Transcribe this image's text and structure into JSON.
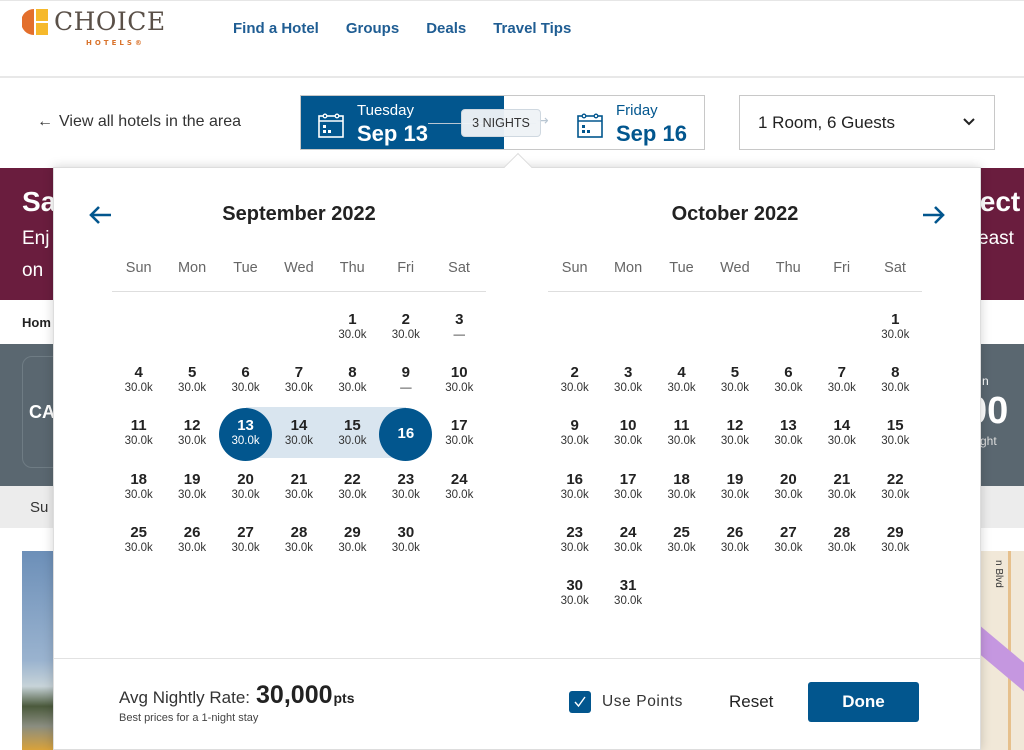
{
  "header": {
    "logo_word": "CHOICE",
    "logo_sub": "HOTELS®",
    "nav": [
      "Find a Hotel",
      "Groups",
      "Deals",
      "Travel Tips"
    ]
  },
  "search": {
    "back_link": "View all hotels in the area",
    "checkin": {
      "day": "Tuesday",
      "date": "Sep 13"
    },
    "checkout": {
      "day": "Friday",
      "date": "Sep 16"
    },
    "nights": "3 NIGHTS",
    "guests": "1 Room, 6 Guests"
  },
  "background": {
    "promo_title": "Sa",
    "promo_line1": "Enj",
    "promo_line2": "on",
    "promo_right_title": "lect",
    "promo_right_line": "east",
    "breadcrumb": "Hom",
    "band_left": "CA",
    "band_right_top": "n",
    "band_right_big": "00",
    "band_right_bottom": "ght",
    "subbar": "Su",
    "map_label": "n Blvd"
  },
  "calendar": {
    "weekdays": [
      "Sun",
      "Mon",
      "Tue",
      "Wed",
      "Thu",
      "Fri",
      "Sat"
    ],
    "selected_start": "2022-09-13",
    "selected_end": "2022-09-16",
    "months": [
      {
        "title": "September 2022",
        "first_weekday": 4,
        "days": [
          {
            "d": "1",
            "p": "30.0k"
          },
          {
            "d": "2",
            "p": "30.0k"
          },
          {
            "d": "3",
            "p": "—"
          },
          {
            "d": "4",
            "p": "30.0k"
          },
          {
            "d": "5",
            "p": "30.0k"
          },
          {
            "d": "6",
            "p": "30.0k"
          },
          {
            "d": "7",
            "p": "30.0k"
          },
          {
            "d": "8",
            "p": "30.0k"
          },
          {
            "d": "9",
            "p": "—"
          },
          {
            "d": "10",
            "p": "30.0k"
          },
          {
            "d": "11",
            "p": "30.0k"
          },
          {
            "d": "12",
            "p": "30.0k"
          },
          {
            "d": "13",
            "p": "30.0k",
            "state": "start"
          },
          {
            "d": "14",
            "p": "30.0k",
            "state": "range"
          },
          {
            "d": "15",
            "p": "30.0k",
            "state": "range"
          },
          {
            "d": "16",
            "p": "",
            "state": "end"
          },
          {
            "d": "17",
            "p": "30.0k"
          },
          {
            "d": "18",
            "p": "30.0k"
          },
          {
            "d": "19",
            "p": "30.0k"
          },
          {
            "d": "20",
            "p": "30.0k"
          },
          {
            "d": "21",
            "p": "30.0k"
          },
          {
            "d": "22",
            "p": "30.0k"
          },
          {
            "d": "23",
            "p": "30.0k"
          },
          {
            "d": "24",
            "p": "30.0k"
          },
          {
            "d": "25",
            "p": "30.0k"
          },
          {
            "d": "26",
            "p": "30.0k"
          },
          {
            "d": "27",
            "p": "30.0k"
          },
          {
            "d": "28",
            "p": "30.0k"
          },
          {
            "d": "29",
            "p": "30.0k"
          },
          {
            "d": "30",
            "p": "30.0k"
          }
        ]
      },
      {
        "title": "October 2022",
        "first_weekday": 6,
        "days": [
          {
            "d": "1",
            "p": "30.0k"
          },
          {
            "d": "2",
            "p": "30.0k"
          },
          {
            "d": "3",
            "p": "30.0k"
          },
          {
            "d": "4",
            "p": "30.0k"
          },
          {
            "d": "5",
            "p": "30.0k"
          },
          {
            "d": "6",
            "p": "30.0k"
          },
          {
            "d": "7",
            "p": "30.0k"
          },
          {
            "d": "8",
            "p": "30.0k"
          },
          {
            "d": "9",
            "p": "30.0k"
          },
          {
            "d": "10",
            "p": "30.0k"
          },
          {
            "d": "11",
            "p": "30.0k"
          },
          {
            "d": "12",
            "p": "30.0k"
          },
          {
            "d": "13",
            "p": "30.0k"
          },
          {
            "d": "14",
            "p": "30.0k"
          },
          {
            "d": "15",
            "p": "30.0k"
          },
          {
            "d": "16",
            "p": "30.0k"
          },
          {
            "d": "17",
            "p": "30.0k"
          },
          {
            "d": "18",
            "p": "30.0k"
          },
          {
            "d": "19",
            "p": "30.0k"
          },
          {
            "d": "20",
            "p": "30.0k"
          },
          {
            "d": "21",
            "p": "30.0k"
          },
          {
            "d": "22",
            "p": "30.0k"
          },
          {
            "d": "23",
            "p": "30.0k"
          },
          {
            "d": "24",
            "p": "30.0k"
          },
          {
            "d": "25",
            "p": "30.0k"
          },
          {
            "d": "26",
            "p": "30.0k"
          },
          {
            "d": "27",
            "p": "30.0k"
          },
          {
            "d": "28",
            "p": "30.0k"
          },
          {
            "d": "29",
            "p": "30.0k"
          },
          {
            "d": "30",
            "p": "30.0k"
          },
          {
            "d": "31",
            "p": "30.0k"
          }
        ]
      }
    ],
    "footer": {
      "avg_label": "Avg Nightly Rate:",
      "avg_value": "30,000",
      "avg_unit": "pts",
      "avg_note": "Best prices for a 1-night stay",
      "use_points_label": "Use Points",
      "use_points_checked": true,
      "reset_label": "Reset",
      "done_label": "Done"
    }
  },
  "colors": {
    "brand_blue": "#02568e",
    "range_fill": "#d9e5ef",
    "promo": "#6a1d3e",
    "logo_orange": "#e36f2c",
    "logo_yellow": "#f6b92b"
  }
}
